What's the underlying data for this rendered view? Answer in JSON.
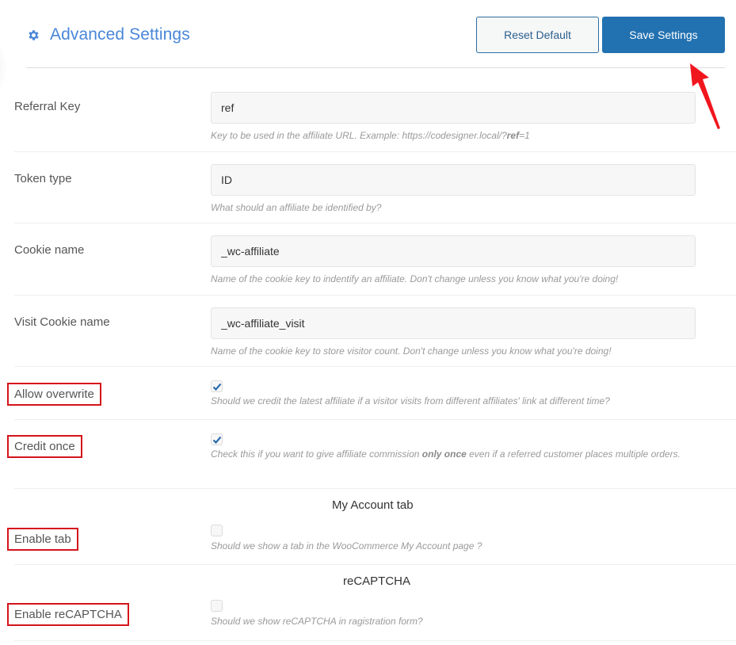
{
  "header": {
    "icon": "gear-icon",
    "title": "Advanced Settings",
    "reset_label": "Reset Default",
    "save_label": "Save Settings"
  },
  "colors": {
    "title": "#4a86d8",
    "primary_button": "#2271b1",
    "annotation_red": "#d4131b"
  },
  "fields": {
    "referral_key": {
      "label": "Referral Key",
      "value": "ref",
      "desc_prefix": "Key to be used in the affiliate URL. Example: https://codesigner.local/?",
      "desc_bold": "ref",
      "desc_suffix": "=1"
    },
    "token_type": {
      "label": "Token type",
      "value": "ID",
      "desc": "What should an affiliate be identified by?"
    },
    "cookie_name": {
      "label": "Cookie name",
      "value": "_wc-affiliate",
      "desc": "Name of the cookie key to indentify an affiliate. Don't change unless you know what you're doing!"
    },
    "visit_cookie_name": {
      "label": "Visit Cookie name",
      "value": "_wc-affiliate_visit",
      "desc": "Name of the cookie key to store visitor count. Don't change unless you know what you're doing!"
    },
    "allow_overwrite": {
      "label": "Allow overwrite",
      "checked": true,
      "desc": "Should we credit the latest affiliate if a visitor visits from different affiliates' link at different time?"
    },
    "credit_once": {
      "label": "Credit once",
      "checked": true,
      "desc_prefix": "Check this if you want to give affiliate commission ",
      "desc_bold": "only once",
      "desc_suffix": " even if a referred customer places multiple orders."
    }
  },
  "sections": {
    "my_account": {
      "heading": "My Account tab",
      "enable_tab": {
        "label": "Enable tab",
        "checked": false,
        "desc": "Should we show a tab in the WooCommerce My Account page ?"
      }
    },
    "recaptcha": {
      "heading": "reCAPTCHA",
      "enable_recaptcha": {
        "label": "Enable reCAPTCHA",
        "checked": false,
        "desc": "Should we show reCAPTCHA in ragistration form?"
      }
    }
  }
}
